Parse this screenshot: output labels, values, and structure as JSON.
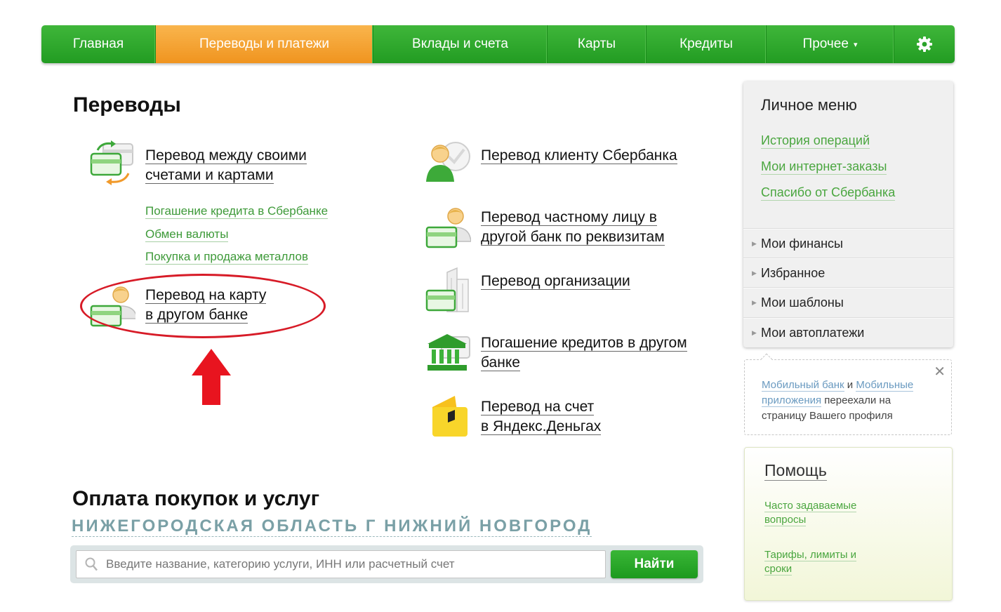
{
  "nav": {
    "items": [
      {
        "label": "Главная",
        "active": false
      },
      {
        "label": "Переводы и платежи",
        "active": true
      },
      {
        "label": "Вклады и счета",
        "active": false
      },
      {
        "label": "Карты",
        "active": false
      },
      {
        "label": "Кредиты",
        "active": false
      },
      {
        "label": "Прочее",
        "active": false
      }
    ],
    "more_caret": "▾",
    "settings_icon": "gear-icon"
  },
  "transfers": {
    "title": "Переводы",
    "own_accounts": {
      "line1": "Перевод между своими",
      "line2": "счетами и картами"
    },
    "sublinks": [
      "Погашение кредита в Сбербанке",
      "Обмен валюты",
      "Покупка и продажа металлов"
    ],
    "card_other_bank": {
      "line1": "Перевод на карту",
      "line2": "в другом банке"
    },
    "sber_client": {
      "line1": "Перевод клиенту Сбербанка"
    },
    "private_person": {
      "line1": "Перевод частному лицу в",
      "line2": "другой банк по реквизитам"
    },
    "organization": {
      "line1": "Перевод организации"
    },
    "credit_other_bank": {
      "line1": "Погашение кредитов в другом",
      "line2": "банке"
    },
    "yandex": {
      "line1": "Перевод на счет",
      "line2": "в Яндекс.Деньгах"
    }
  },
  "payments": {
    "title": "Оплата покупок и услуг",
    "region": "НИЖЕГОРОДСКАЯ ОБЛАСТЬ Г НИЖНИЙ НОВГОРОД",
    "search_placeholder": "Введите название, категорию услуги, ИНН или расчетный счет",
    "search_button": "Найти"
  },
  "sidebar": {
    "title": "Личное меню",
    "links": [
      "История операций",
      "Мои интернет-заказы",
      "Спасибо от Сбербанка"
    ],
    "sections": [
      "Мои финансы",
      "Избранное",
      "Мои шаблоны",
      "Мои автоплатежи"
    ]
  },
  "notice": {
    "link1": "Мобильный банк",
    "and": " и ",
    "link2": "Мобильные приложения",
    "text": " переехали на страницу Вашего профиля",
    "close": "✕"
  },
  "help": {
    "title": "Помощь",
    "faq": "Часто задаваемые вопросы",
    "tariffs": "Тарифы, лимиты и сроки"
  },
  "colors": {
    "nav_green": "#2aa32a",
    "nav_active_orange": "#f4a236",
    "link_green": "#3e9a39",
    "annotation_red": "#d71b27"
  }
}
